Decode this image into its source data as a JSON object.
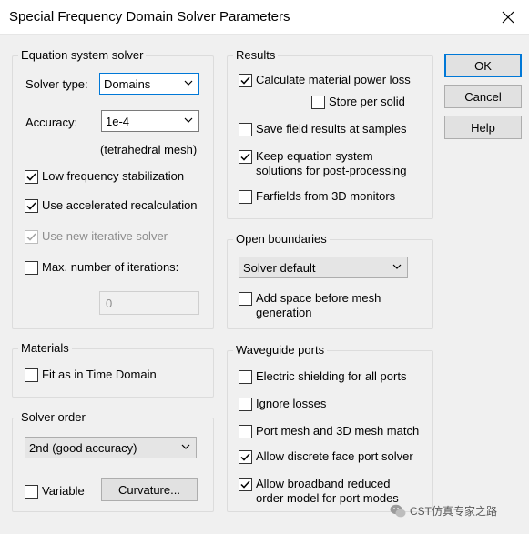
{
  "window": {
    "title": "Special Frequency Domain Solver Parameters",
    "close_icon": "close-icon"
  },
  "equation_solver": {
    "title": "Equation system solver",
    "solver_type_label": "Solver type:",
    "solver_type_value": "Domains",
    "accuracy_label": "Accuracy:",
    "accuracy_value": "1e-4",
    "accuracy_note": "(tetrahedral mesh)",
    "low_freq_label": "Low frequency stabilization",
    "low_freq_checked": true,
    "accel_label": "Use accelerated recalculation",
    "accel_checked": true,
    "iterative_label": "Use new iterative solver",
    "iterative_checked": true,
    "iterative_disabled": true,
    "max_iter_label": "Max. number of iterations:",
    "max_iter_checked": false,
    "max_iter_value": "0"
  },
  "materials": {
    "title": "Materials",
    "fit_label": "Fit as in Time Domain",
    "fit_checked": false
  },
  "solver_order": {
    "title": "Solver order",
    "value": "2nd (good accuracy)",
    "variable_label": "Variable",
    "variable_checked": false,
    "curvature_button": "Curvature..."
  },
  "results": {
    "title": "Results",
    "power_loss_label": "Calculate material power loss",
    "power_loss_checked": true,
    "store_per_solid_label": "Store per solid",
    "store_per_solid_checked": false,
    "save_field_label": "Save field results at samples",
    "save_field_checked": false,
    "keep_solutions_label_1": "Keep equation system",
    "keep_solutions_label_2": "solutions for post-processing",
    "keep_solutions_checked": true,
    "farfields_label": "Farfields from 3D monitors",
    "farfields_checked": false
  },
  "open_boundaries": {
    "title": "Open boundaries",
    "value": "Solver default",
    "add_space_label_1": "Add space before mesh",
    "add_space_label_2": "generation",
    "add_space_checked": false
  },
  "waveguide_ports": {
    "title": "Waveguide ports",
    "shielding_label": "Electric shielding for all ports",
    "shielding_checked": false,
    "ignore_losses_label": "Ignore losses",
    "ignore_losses_checked": false,
    "port_mesh_label": "Port mesh and 3D mesh match",
    "port_mesh_checked": false,
    "discrete_face_label": "Allow discrete face port solver",
    "discrete_face_checked": true,
    "broadband_label_1": "Allow broadband reduced",
    "broadband_label_2": "order model for port modes",
    "broadband_checked": true
  },
  "buttons": {
    "ok": "OK",
    "cancel": "Cancel",
    "help": "Help"
  },
  "watermark": {
    "text": "CST仿真专家之路"
  },
  "colors": {
    "accent": "#0078d7",
    "check": "#000000",
    "disabled": "#8d8d8d"
  }
}
